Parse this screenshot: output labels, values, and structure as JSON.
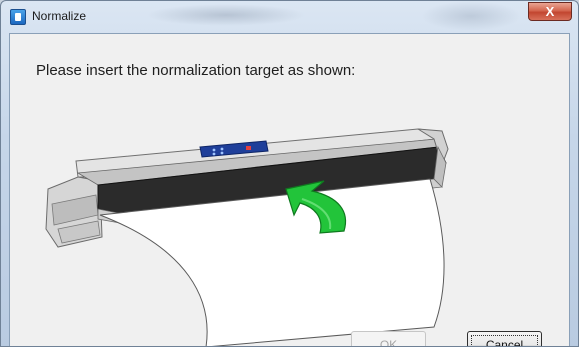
{
  "window": {
    "title": "Normalize",
    "close_label": "X"
  },
  "dialog": {
    "instruction": "Please insert the normalization target as shown:",
    "ok_label": "OK",
    "cancel_label": "Cancel",
    "ok_enabled": false
  },
  "illustration": {
    "subject": "scanner-with-paper-insertion",
    "arrow_color": "#22c43a",
    "scanner_color": "#d8d8d8",
    "feed_color": "#2b2b2b",
    "panel_color": "#1f3f9a"
  }
}
